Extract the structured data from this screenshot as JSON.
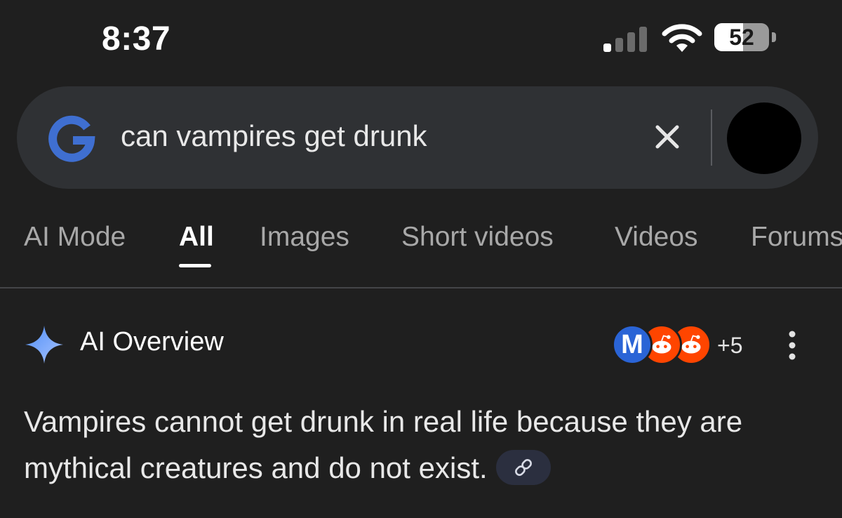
{
  "status_bar": {
    "time": "8:37",
    "battery_level": 52,
    "battery_text": "52",
    "signal_bars_active": 1,
    "icons": [
      "signal-icon",
      "wifi-icon",
      "battery-icon"
    ]
  },
  "search": {
    "query": "can vampires get drunk",
    "logo_icon": "google-g-icon",
    "clear_icon": "close-icon"
  },
  "tabs": [
    {
      "label": "AI Mode",
      "active": false
    },
    {
      "label": "All",
      "active": true
    },
    {
      "label": "Images",
      "active": false
    },
    {
      "label": "Short videos",
      "active": false
    },
    {
      "label": "Videos",
      "active": false
    },
    {
      "label": "Forums",
      "active": false
    }
  ],
  "ai_overview": {
    "title": "AI Overview",
    "sources": {
      "icons": [
        {
          "name": "source-m-icon",
          "letter": "M"
        },
        {
          "name": "reddit-icon"
        },
        {
          "name": "reddit-icon"
        }
      ],
      "more": "+5"
    },
    "answer": "Vampires cannot get drunk in real life because they are mythical creatures and do not exist."
  },
  "colors": {
    "background": "#1f1f1f",
    "search_bar": "#2f3134",
    "google_blue": "#4285f4",
    "reddit_orange": "#ff4500",
    "link_chip": "#2b2f3f"
  }
}
